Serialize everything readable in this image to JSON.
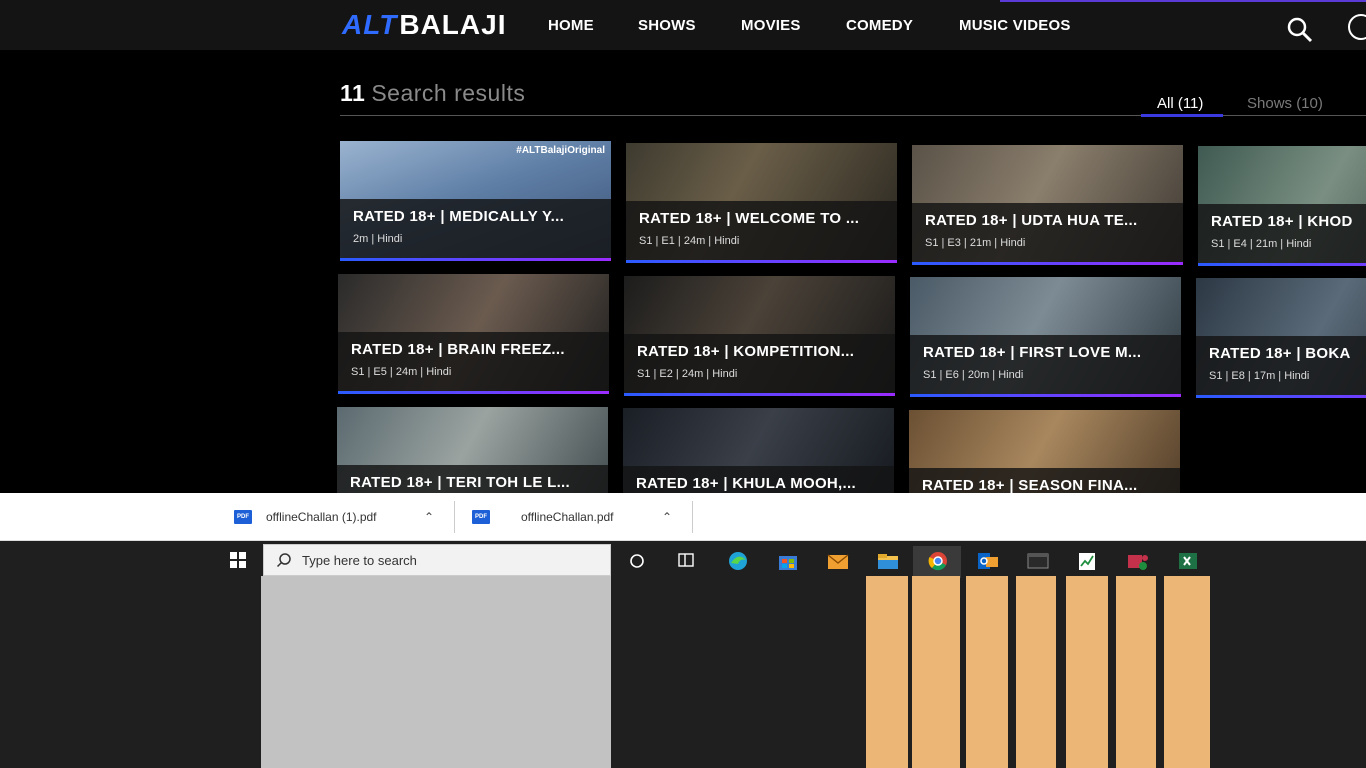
{
  "nav": {
    "logo_alt": "ALT",
    "logo_balaji": "BALAJI",
    "links": [
      "HOME",
      "SHOWS",
      "MOVIES",
      "COMEDY",
      "MUSIC VIDEOS"
    ]
  },
  "results": {
    "count": "11",
    "label": "Search results",
    "tabs": {
      "all": "All (11)",
      "shows": "Shows (10)"
    }
  },
  "cards": [
    {
      "title": "RATED 18+ | MEDICALLY Y...",
      "meta": "2m | Hindi",
      "tag": "#ALTBalajiOriginal"
    },
    {
      "title": "RATED 18+ | WELCOME TO ...",
      "meta": "S1 | E1 | 24m | Hindi"
    },
    {
      "title": "RATED 18+ | UDTA HUA TE...",
      "meta": "S1 | E3 | 21m | Hindi"
    },
    {
      "title": "RATED 18+ | KHOD",
      "meta": "S1 | E4 | 21m | Hindi"
    },
    {
      "title": "RATED 18+ | BRAIN FREEZ...",
      "meta": "S1 | E5 | 24m | Hindi"
    },
    {
      "title": "RATED 18+ | KOMPETITION...",
      "meta": "S1 | E2 | 24m | Hindi"
    },
    {
      "title": "RATED 18+ | FIRST LOVE M...",
      "meta": "S1 | E6 | 20m | Hindi"
    },
    {
      "title": "RATED 18+ | BOKA",
      "meta": "S1 | E8 | 17m | Hindi"
    },
    {
      "title": "RATED 18+ | TERI TOH LE L...",
      "meta": ""
    },
    {
      "title": "RATED 18+ | KHULA MOOH,...",
      "meta": ""
    },
    {
      "title": "RATED 18+ | SEASON FINA...",
      "meta": ""
    }
  ],
  "downloads": [
    {
      "name": "offlineChallan (1).pdf",
      "icon": "PDF"
    },
    {
      "name": "offlineChallan.pdf",
      "icon": "PDF"
    }
  ],
  "taskbar": {
    "search_placeholder": "Type here to search",
    "icons": [
      "task-view-icon",
      "widgets-icon",
      "edge-icon",
      "store-icon",
      "mail-icon",
      "file-explorer-icon",
      "chrome-icon",
      "outlook-icon",
      "terminal-icon",
      "sheets-icon",
      "teams-icon",
      "excel-icon"
    ]
  },
  "colors": {
    "brand_blue": "#2f6bff",
    "progress_end": "#9b2bff",
    "taskbar_stripe": "#ecb776"
  }
}
